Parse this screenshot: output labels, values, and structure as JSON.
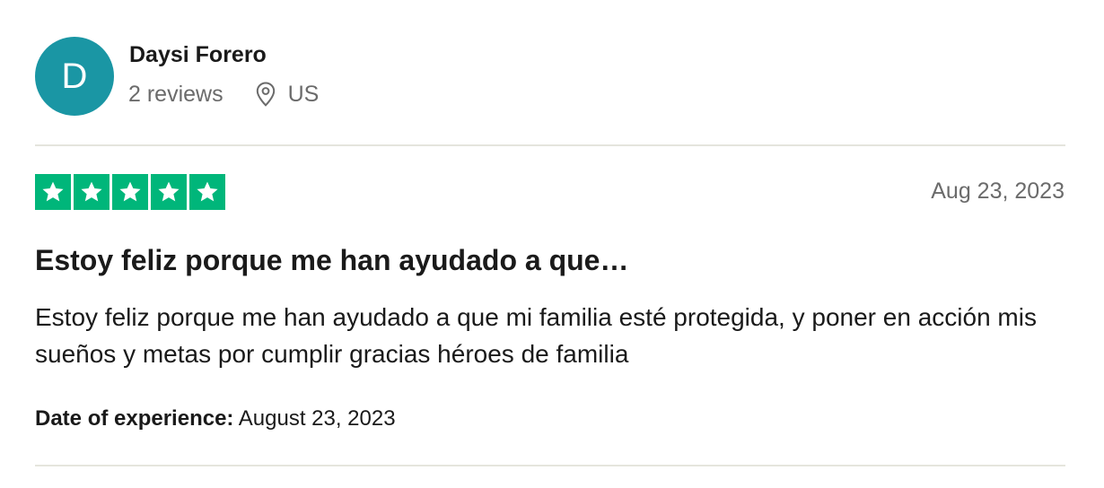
{
  "reviewer": {
    "initial": "D",
    "name": "Daysi Forero",
    "reviews_count": "2 reviews",
    "location": "US",
    "avatar_color": "#1a96a4"
  },
  "review": {
    "rating": 5,
    "rating_max": 5,
    "star_color": "#00b67a",
    "date": "Aug 23, 2023",
    "title": "Estoy feliz porque me han ayudado a que…",
    "body": "Estoy feliz porque me han ayudado a que mi familia esté protegida, y poner en acción mis sueños y metas por cumplir gracias héroes de familia",
    "experience_label": "Date of experience:",
    "experience_date": "August 23, 2023"
  }
}
